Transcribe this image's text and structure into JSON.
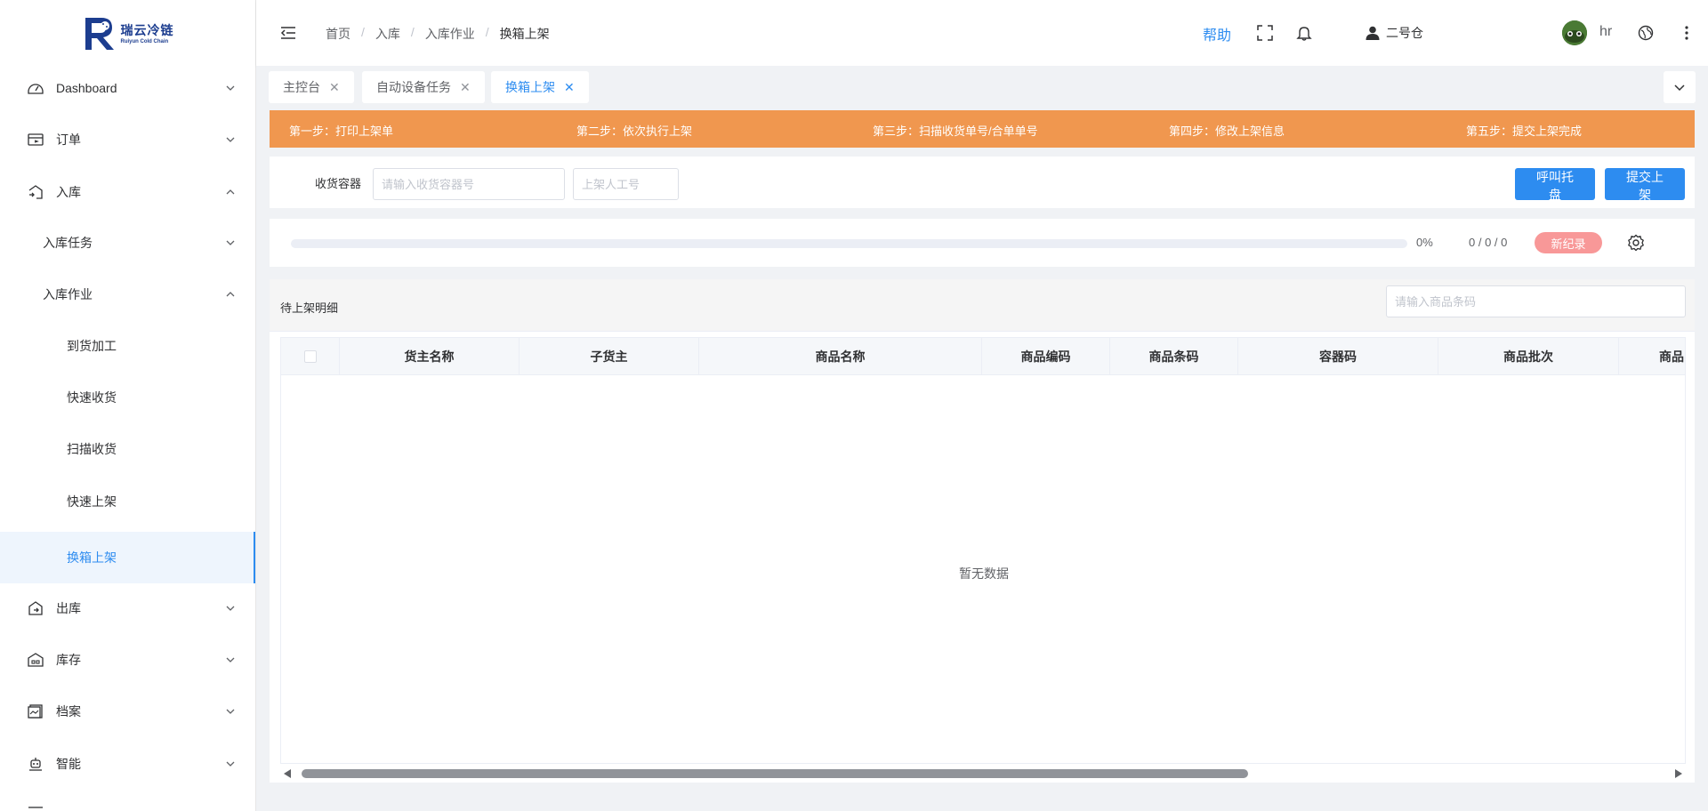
{
  "brand": {
    "name_cn": "瑞云冷链",
    "name_en": "Ruiyun Cold Chain"
  },
  "sidebar": {
    "items": [
      {
        "label": "Dashboard",
        "icon": "dashboard-icon",
        "expanded": false
      },
      {
        "label": "订单",
        "icon": "order-icon",
        "expanded": false
      },
      {
        "label": "入库",
        "icon": "inbound-icon",
        "expanded": true
      },
      {
        "label": "入库任务",
        "expanded": false
      },
      {
        "label": "入库作业",
        "expanded": true
      },
      {
        "label": "到货加工"
      },
      {
        "label": "快速收货"
      },
      {
        "label": "扫描收货"
      },
      {
        "label": "快速上架"
      },
      {
        "label": "换箱上架",
        "active": true
      },
      {
        "label": "出库",
        "icon": "outbound-icon",
        "expanded": false
      },
      {
        "label": "库存",
        "icon": "inventory-icon",
        "expanded": false
      },
      {
        "label": "档案",
        "icon": "archive-icon",
        "expanded": false
      },
      {
        "label": "智能",
        "icon": "robot-icon",
        "expanded": false
      }
    ]
  },
  "header": {
    "breadcrumb": [
      "首页",
      "入库",
      "入库作业",
      "换箱上架"
    ],
    "help": "帮助",
    "warehouse": "二号仓",
    "username": "hr"
  },
  "tabs": [
    {
      "label": "主控台",
      "active": false
    },
    {
      "label": "自动设备任务",
      "active": false
    },
    {
      "label": "换箱上架",
      "active": true
    }
  ],
  "steps": [
    "第一步：打印上架单",
    "第二步：依次执行上架",
    "第三步：扫描收货单号/合单单号",
    "第四步：修改上架信息",
    "第五步：提交上架完成"
  ],
  "filter": {
    "label": "收货容器",
    "container_placeholder": "请输入收货容器号",
    "worker_placeholder": "上架人工号",
    "call_pallet_button": "呼叫托盘",
    "submit_button": "提交上架"
  },
  "progress": {
    "value": 0,
    "percent_text": "0%",
    "count_text": "0 / 0 / 0",
    "badge": "新纪录"
  },
  "table": {
    "title": "待上架明细",
    "search_placeholder": "请输入商品条码",
    "columns": [
      "货主名称",
      "子货主",
      "商品名称",
      "商品编码",
      "商品条码",
      "容器码",
      "商品批次",
      "商品"
    ],
    "rows": [],
    "empty_text": "暂无数据"
  },
  "colors": {
    "primary": "#2d8cf0",
    "steps_bar": "#f0974f",
    "badge": "#f89898",
    "brand": "#1c3d8f"
  }
}
